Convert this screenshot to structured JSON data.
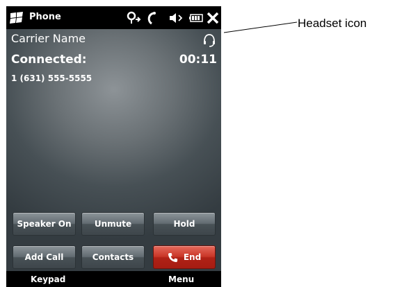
{
  "statusbar": {
    "app_title": "Phone",
    "icons": [
      "start-flag-icon",
      "location-icon",
      "call-signal-icon",
      "speaker-volume-icon",
      "battery-icon",
      "close-icon"
    ]
  },
  "call": {
    "carrier": "Carrier Name",
    "status": "Connected:",
    "timer": "00:11",
    "number": "1 (631) 555-5555",
    "headset_icon": "headset-icon"
  },
  "buttons": {
    "speaker_on": "Speaker On",
    "unmute": "Unmute",
    "hold": "Hold",
    "add_call": "Add Call",
    "contacts": "Contacts",
    "end": "End",
    "end_icon": "phone-handset-icon"
  },
  "softkeys": {
    "left": "Keypad",
    "right": "Menu"
  },
  "callout": {
    "label": "Headset icon"
  },
  "colors": {
    "end_button": "#c83526",
    "button_gray": "#626b71",
    "background": "#000000"
  }
}
